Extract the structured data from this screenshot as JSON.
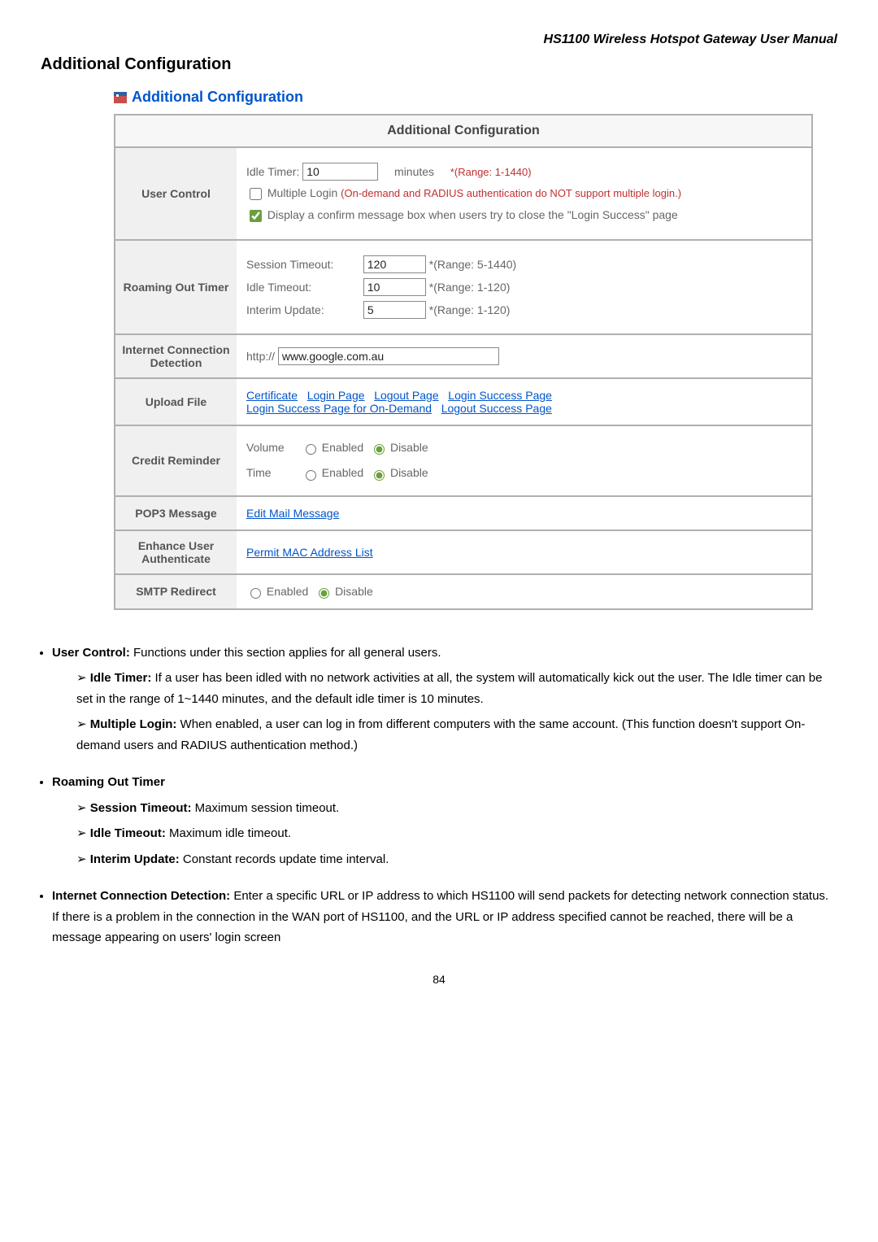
{
  "doc_title": "HS1100  Wireless  Hotspot  Gateway  User  Manual",
  "page_heading": "Additional Configuration",
  "footer_page": "84",
  "section": {
    "title": "Additional Configuration",
    "table_header": "Additional Configuration",
    "rows": {
      "user_control": {
        "label": "User Control",
        "idle_timer_label": "Idle Timer:",
        "idle_timer_value": "10",
        "minutes": "minutes",
        "idle_range": "*(Range: 1-1440)",
        "multiple_login_label": "Multiple Login",
        "multiple_login_note": "(On-demand and RADIUS authentication do NOT support multiple login.)",
        "display_confirm": "Display a confirm message box when users try to close the \"Login Success\" page"
      },
      "roaming": {
        "label": "Roaming Out Timer",
        "session_label": "Session Timeout:",
        "session_value": "120",
        "session_range": "*(Range: 5-1440)",
        "idle_label": "Idle Timeout:",
        "idle_value": "10",
        "idle_range": "*(Range: 1-120)",
        "interim_label": "Interim Update:",
        "interim_value": "5",
        "interim_range": "*(Range: 1-120)"
      },
      "internet": {
        "label": "Internet Connection Detection",
        "prefix": "http://",
        "url": "www.google.com.au"
      },
      "upload": {
        "label": "Upload File",
        "links": [
          "Certificate",
          "Login Page",
          "Logout Page",
          "Login Success Page",
          "Login Success Page for On-Demand",
          "Logout Success Page"
        ]
      },
      "credit": {
        "label": "Credit Reminder",
        "volume": "Volume",
        "time": "Time",
        "enabled": "Enabled",
        "disable": "Disable"
      },
      "pop3": {
        "label": "POP3 Message",
        "link": "Edit Mail Message"
      },
      "enhance": {
        "label": "Enhance User Authenticate",
        "link": "Permit MAC Address List"
      },
      "smtp": {
        "label": "SMTP Redirect",
        "enabled": "Enabled",
        "disable": "Disable"
      }
    }
  },
  "body": {
    "user_control_head": "User Control:",
    "user_control_rest": " Functions under this section applies for all general users.",
    "idle_timer_head": "Idle Timer:",
    "idle_timer_rest": " If a user has been idled with no network activities at all, the system will automatically kick out the user. The Idle timer can be set in the range of 1~1440 minutes, and the default idle timer is 10 minutes.",
    "multiple_login_head": "Multiple Login:",
    "multiple_login_rest": " When enabled, a user can log in from different computers with the same account. (This function doesn't support On-demand users and RADIUS authentication method.)",
    "roaming_head": "Roaming Out Timer",
    "session_head": "Session Timeout:",
    "session_rest": " Maximum session timeout.",
    "idle_head": "Idle Timeout:",
    "idle_rest": " Maximum idle timeout.",
    "interim_head": "Interim Update:",
    "interim_rest": " Constant records update time interval.",
    "internet_head": "Internet Connection Detection:",
    "internet_rest": " Enter a specific URL or IP address to which HS1100 will send packets for detecting network connection status. If there is a problem in the connection in the WAN port of HS1100, and the URL or IP address specified cannot be reached, there will be a message appearing on users' login screen"
  }
}
